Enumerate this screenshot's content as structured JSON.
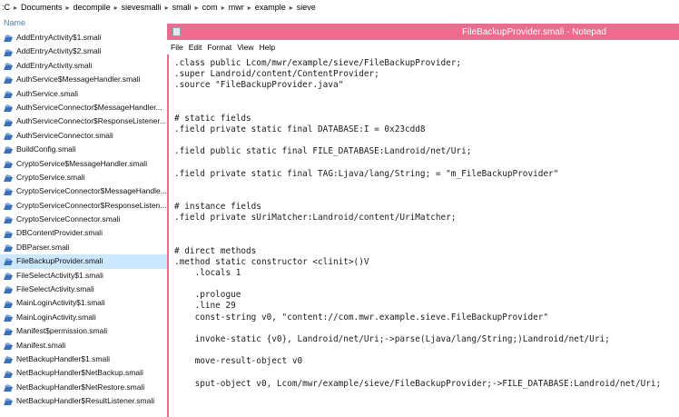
{
  "breadcrumb": [
    ":C",
    "Documents",
    "decompile",
    "sievesmalli",
    "smali",
    "com",
    "mwr",
    "example",
    "sieve"
  ],
  "explorer": {
    "column_header": "Name",
    "selected_index": 16,
    "files": [
      "AddEntryActivity$1.smali",
      "AddEntryActivity$2.smali",
      "AddEntryActivity.smali",
      "AuthService$MessageHandler.smali",
      "AuthService.smali",
      "AuthServiceConnector$MessageHandler...",
      "AuthServiceConnector$ResponseListener...",
      "AuthServiceConnector.smali",
      "BuildConfig.smali",
      "CryptoService$MessageHandler.smali",
      "CryptoService.smali",
      "CryptoServiceConnector$MessageHandle...",
      "CryptoServiceConnector$ResponseListen...",
      "CryptoServiceConnector.smali",
      "DBContentProvider.smali",
      "DBParser.smali",
      "FileBackupProvider.smali",
      "FileSelectActivity$1.smali",
      "FileSelectActivity.smali",
      "MainLoginActivity$1.smali",
      "MainLoginActivity.smali",
      "Manifest$permission.smali",
      "Manifest.smali",
      "NetBackupHandler$1.smali",
      "NetBackupHandler$NetBackup.smali",
      "NetBackupHandler$NetRestore.smali",
      "NetBackupHandler$ResultListener.smali"
    ]
  },
  "notepad": {
    "title": "FileBackupProvider.smali - Notepad",
    "menu": [
      "File",
      "Edit",
      "Format",
      "View",
      "Help"
    ],
    "content": ".class public Lcom/mwr/example/sieve/FileBackupProvider;\n.super Landroid/content/ContentProvider;\n.source \"FileBackupProvider.java\"\n\n\n# static fields\n.field private static final DATABASE:I = 0x23cdd8\n\n.field public static final FILE_DATABASE:Landroid/net/Uri;\n\n.field private static final TAG:Ljava/lang/String; = \"m_FileBackupProvider\"\n\n\n# instance fields\n.field private sUriMatcher:Landroid/content/UriMatcher;\n\n\n# direct methods\n.method static constructor <clinit>()V\n    .locals 1\n\n    .prologue\n    .line 29\n    const-string v0, \"content://com.mwr.example.sieve.FileBackupProvider\"\n\n    invoke-static {v0}, Landroid/net/Uri;->parse(Ljava/lang/String;)Landroid/net/Uri;\n\n    move-result-object v0\n\n    sput-object v0, Lcom/mwr/example/sieve/FileBackupProvider;->FILE_DATABASE:Landroid/net/Uri;"
  },
  "icons": {
    "file": "smali-file-icon",
    "notepad": "notepad-icon",
    "separator": "chevron-right-icon"
  },
  "colors": {
    "title_bar": "#ee6b8f",
    "selected_row": "#cce8ff",
    "header_text": "#4f7fb0"
  }
}
